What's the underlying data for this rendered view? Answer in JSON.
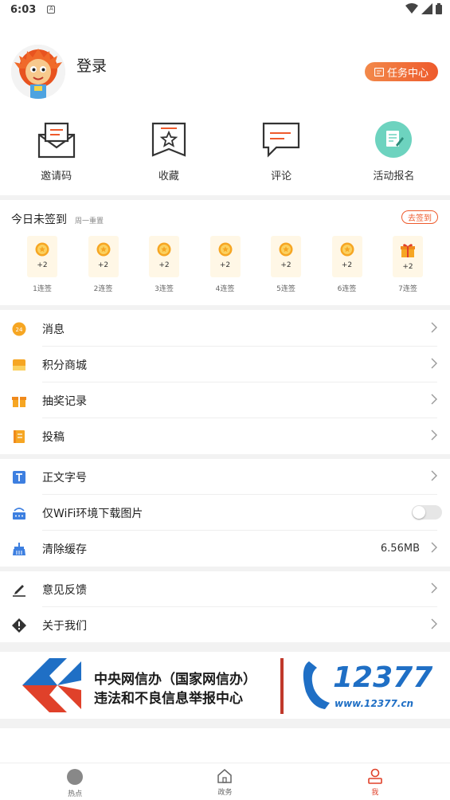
{
  "status_bar": {
    "time": "6:03"
  },
  "profile": {
    "login_label": "登录",
    "task_center_label": "任务中心"
  },
  "quick_actions": [
    {
      "label": "邀请码",
      "icon": "envelope-icon"
    },
    {
      "label": "收藏",
      "icon": "star-bookmark-icon"
    },
    {
      "label": "评论",
      "icon": "comment-icon"
    },
    {
      "label": "活动报名",
      "icon": "signup-icon"
    }
  ],
  "checkin": {
    "title": "今日未签到",
    "subtitle": "周一重置",
    "go_label": "去签到",
    "days": [
      {
        "points": "+2",
        "label": "1连签",
        "icon": "coin-icon"
      },
      {
        "points": "+2",
        "label": "2连签",
        "icon": "coin-icon"
      },
      {
        "points": "+2",
        "label": "3连签",
        "icon": "coin-icon"
      },
      {
        "points": "+2",
        "label": "4连签",
        "icon": "coin-icon"
      },
      {
        "points": "+2",
        "label": "5连签",
        "icon": "coin-icon"
      },
      {
        "points": "+2",
        "label": "6连签",
        "icon": "coin-icon"
      },
      {
        "points": "+2",
        "label": "7连签",
        "icon": "gift-icon"
      }
    ]
  },
  "menu_group1": [
    {
      "label": "消息",
      "icon": "message-icon"
    },
    {
      "label": "积分商城",
      "icon": "points-mall-icon"
    },
    {
      "label": "抽奖记录",
      "icon": "lottery-gift-icon"
    },
    {
      "label": "投稿",
      "icon": "submit-note-icon"
    }
  ],
  "menu_group2": [
    {
      "label": "正文字号",
      "icon": "font-size-icon"
    },
    {
      "label": "仅WiFi环境下载图片",
      "icon": "wifi-download-icon",
      "toggle_on": false
    },
    {
      "label": "清除缓存",
      "icon": "broom-icon",
      "value": "6.56MB"
    }
  ],
  "menu_group3": [
    {
      "label": "意见反馈",
      "icon": "pen-icon"
    },
    {
      "label": "关于我们",
      "icon": "info-diamond-icon"
    }
  ],
  "banner": {
    "line1": "中央网信办（国家网信办）",
    "line2": "违法和不良信息举报中心",
    "hotline": "12377",
    "url": "www.12377.cn"
  },
  "bottom_nav": [
    {
      "label": "热点",
      "icon": "hot-circle-icon",
      "active": false
    },
    {
      "label": "政务",
      "icon": "home-icon",
      "active": false
    },
    {
      "label": "我",
      "icon": "user-icon",
      "active": true
    }
  ],
  "colors": {
    "accent": "#ee5a2c",
    "active_nav": "#e0412a"
  }
}
